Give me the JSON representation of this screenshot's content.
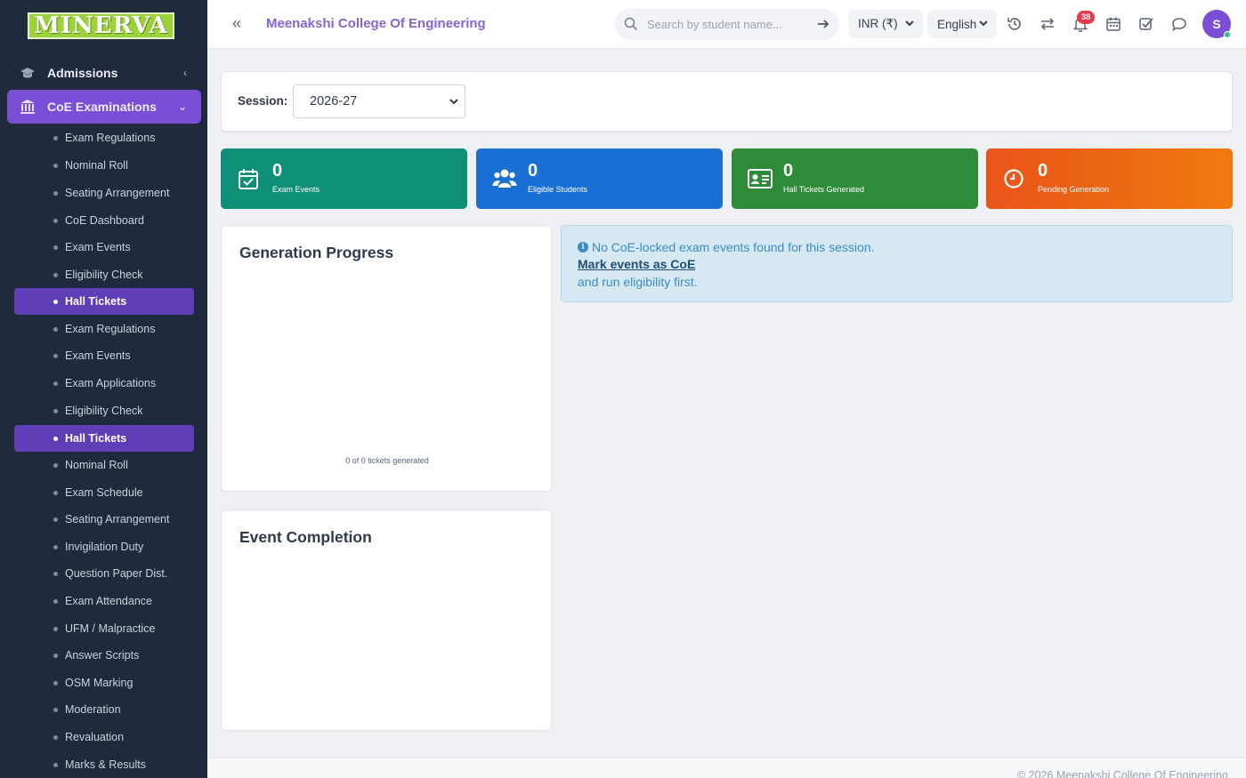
{
  "sidebar": {
    "logo_text": "MINERVA",
    "top_items": [
      {
        "label": "Admissions",
        "icon": "graduation-cap-icon"
      },
      {
        "label": "CoE Examinations",
        "icon": "institution-icon"
      }
    ],
    "sub_items": [
      {
        "label": "Exam Regulations",
        "active": false
      },
      {
        "label": "Nominal Roll",
        "active": false
      },
      {
        "label": "Seating Arrangement",
        "active": false
      },
      {
        "label": "CoE Dashboard",
        "active": false
      },
      {
        "label": "Exam Events",
        "active": false
      },
      {
        "label": "Eligibility Check",
        "active": false
      },
      {
        "label": "Hall Tickets",
        "active": true
      },
      {
        "label": "Exam Regulations",
        "active": false
      },
      {
        "label": "Exam Events",
        "active": false
      },
      {
        "label": "Exam Applications",
        "active": false
      },
      {
        "label": "Eligibility Check",
        "active": false
      },
      {
        "label": "Hall Tickets",
        "active": true
      },
      {
        "label": "Nominal Roll",
        "active": false
      },
      {
        "label": "Exam Schedule",
        "active": false
      },
      {
        "label": "Seating Arrangement",
        "active": false
      },
      {
        "label": "Invigilation Duty",
        "active": false
      },
      {
        "label": "Question Paper Dist.",
        "active": false
      },
      {
        "label": "Exam Attendance",
        "active": false
      },
      {
        "label": "UFM / Malpractice",
        "active": false
      },
      {
        "label": "Answer Scripts",
        "active": false
      },
      {
        "label": "OSM Marking",
        "active": false
      },
      {
        "label": "Moderation",
        "active": false
      },
      {
        "label": "Revaluation",
        "active": false
      },
      {
        "label": "Marks & Results",
        "active": false
      }
    ]
  },
  "header": {
    "college_name": "Meenakshi College Of Engineering",
    "search_placeholder": "Search by student name...",
    "currency": "INR (₹)",
    "language": "English",
    "notification_count": "38",
    "avatar_initial": "S"
  },
  "session": {
    "label": "Session:",
    "value": "2026-27"
  },
  "stats": [
    {
      "value": "0",
      "label": "Exam Events",
      "icon": "calendar-check-icon",
      "color": "#0f8f78"
    },
    {
      "value": "0",
      "label": "Eligible Students",
      "icon": "users-icon",
      "color": "#1a6fd4"
    },
    {
      "value": "0",
      "label": "Hall Tickets Generated",
      "icon": "id-card-icon",
      "color": "#2e8b3a"
    },
    {
      "value": "0",
      "label": "Pending Generation",
      "icon": "clock-icon",
      "color": "#ef6a14"
    }
  ],
  "generation_progress": {
    "title": "Generation Progress",
    "caption": "0 of 0 tickets generated"
  },
  "event_completion": {
    "title": "Event Completion"
  },
  "alert": {
    "message": "No CoE-locked exam events found for this session.",
    "link_text": "Mark events as CoE",
    "suffix": "and run eligibility first."
  },
  "footer": {
    "text": "© 2026 Meenakshi College Of Engineering"
  }
}
